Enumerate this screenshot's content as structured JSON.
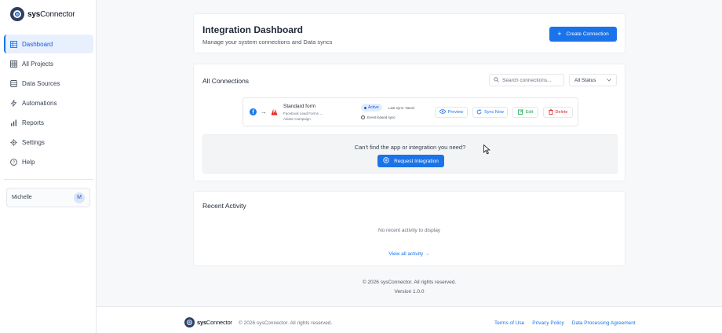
{
  "app": {
    "name_bold": "sys",
    "name_rest": "Connector"
  },
  "sidebar": {
    "items": [
      {
        "label": "Dashboard",
        "icon": "grid-icon",
        "active": true
      },
      {
        "label": "All Projects",
        "icon": "table-icon",
        "active": false
      },
      {
        "label": "Data Sources",
        "icon": "database-icon",
        "active": false
      },
      {
        "label": "Automations",
        "icon": "lightning-icon",
        "active": false
      },
      {
        "label": "Reports",
        "icon": "bar-chart-icon",
        "active": false
      },
      {
        "label": "Settings",
        "icon": "gear-icon",
        "active": false
      },
      {
        "label": "Help",
        "icon": "help-circle-icon",
        "active": false
      }
    ],
    "user": {
      "name": "Michelle",
      "initial": "M"
    }
  },
  "header": {
    "title": "Integration Dashboard",
    "subtitle": "Manage your system connections and Data syncs",
    "create_button": "Create Connection"
  },
  "connections": {
    "title": "All Connections",
    "search_placeholder": "Search connections...",
    "status_filter": "All Status",
    "rows": [
      {
        "name": "Standard form",
        "source": "Facebook Lead Forms →",
        "destination": "Adobe Campaign",
        "status": "Active",
        "last_sync": "Last sync: Never",
        "sync_type": "Event-based sync",
        "preview_label": "Preview",
        "sync_label": "Sync Now",
        "edit_label": "Edit",
        "delete_label": "Delete"
      }
    ],
    "request_text": "Can't find the app or integration you need?",
    "request_button": "Request Integration"
  },
  "activity": {
    "title": "Recent Activity",
    "empty_text": "No recent activity to display",
    "view_all": "View all activity →"
  },
  "page_footer": {
    "copyright": "© 2026 sysConnector. All rights reserved.",
    "version": "Version 1.0.0"
  },
  "site_footer": {
    "copyright": "© 2026 sysConnector. All rights reserved.",
    "links": [
      "Terms of Use",
      "Privacy Policy",
      "Data Processing Agreement"
    ]
  },
  "colors": {
    "accent": "#1a73e8",
    "edit": "#16a34a",
    "delete": "#dc2626"
  }
}
